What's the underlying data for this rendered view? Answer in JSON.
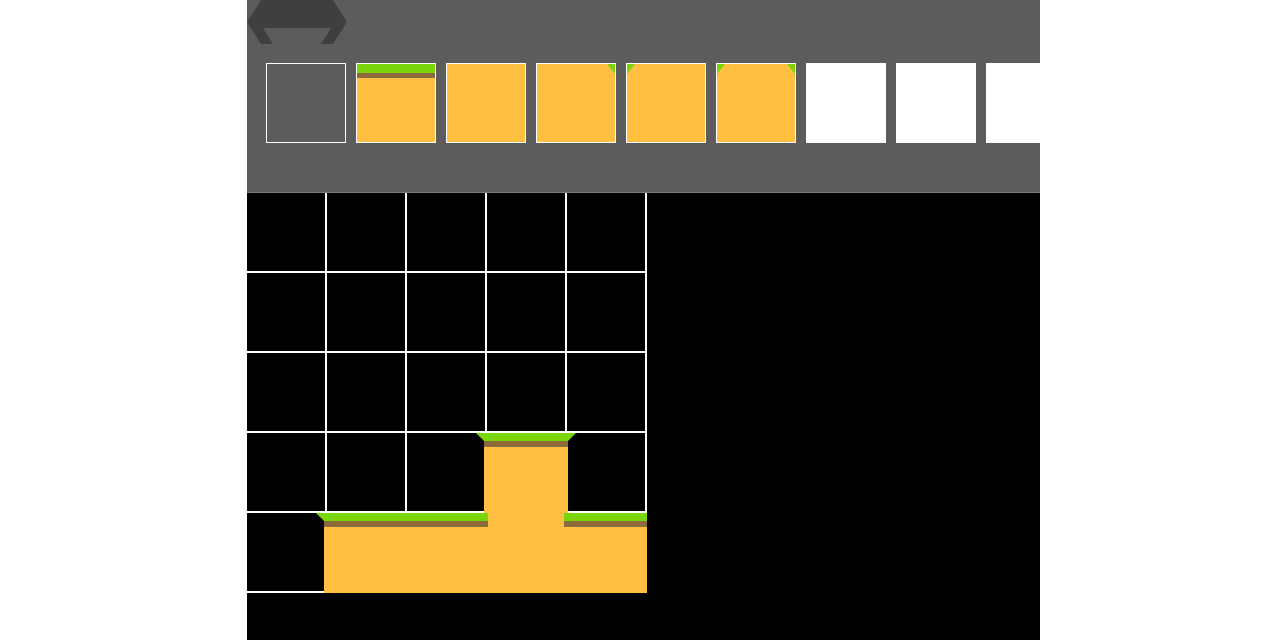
{
  "app": {
    "logo_icon": "double-arrow-logo-icon",
    "colors": {
      "toolbar": "#5c5c5c",
      "logo": "#3f3f3f",
      "canvas_bg": "#000000",
      "grid_line": "#ffffff",
      "dirt": "#ffbf40",
      "grass": "#7ad60a",
      "grass_shadow": "#8c6a3a"
    }
  },
  "palette": {
    "selected_index": 0,
    "tiles": [
      {
        "name": "empty-tile",
        "icon": "empty-tile-icon"
      },
      {
        "name": "grass-top-tile",
        "icon": "grass-top-tile-icon"
      },
      {
        "name": "dirt-tile",
        "icon": "dirt-tile-icon"
      },
      {
        "name": "dirt-corner-right-tile",
        "icon": "dirt-corner-right-icon"
      },
      {
        "name": "dirt-corner-left-tile",
        "icon": "dirt-corner-left-icon"
      },
      {
        "name": "dirt-corner-both-tile",
        "icon": "dirt-corner-both-icon"
      },
      {
        "name": "blank-tile",
        "icon": "blank-tile-icon"
      },
      {
        "name": "blank-tile",
        "icon": "blank-tile-icon"
      },
      {
        "name": "blank-tile",
        "icon": "blank-tile-icon"
      }
    ]
  },
  "map": {
    "columns": 5,
    "rows": 5,
    "tiles": [
      [
        "empty",
        "empty",
        "empty",
        "empty",
        "empty"
      ],
      [
        "empty",
        "empty",
        "empty",
        "empty",
        "empty"
      ],
      [
        "empty",
        "empty",
        "empty",
        "empty",
        "empty"
      ],
      [
        "empty",
        "empty",
        "empty",
        "grass-top",
        "empty"
      ],
      [
        "empty",
        "grass-top",
        "grass-top",
        "dirt",
        "grass-top"
      ]
    ]
  }
}
